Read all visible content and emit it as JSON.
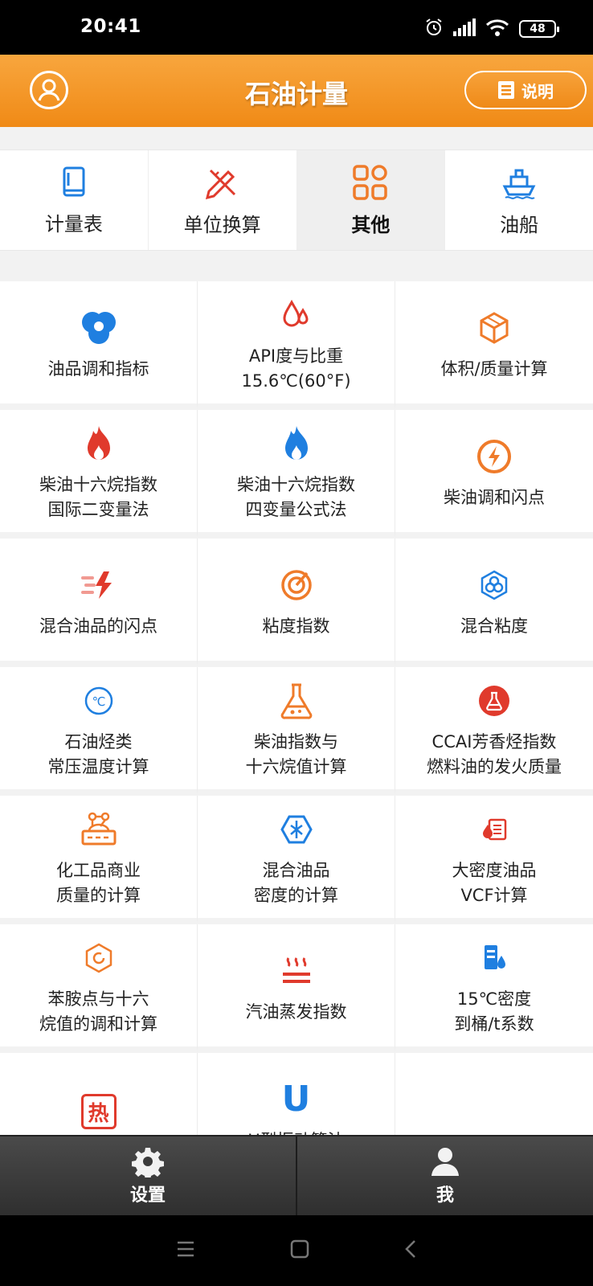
{
  "status_bar": {
    "time": "20:41",
    "battery": "48"
  },
  "header": {
    "title": "石油计量",
    "help_label": "说明"
  },
  "tabs": [
    {
      "label": "计量表",
      "icon": "book-icon",
      "active": false
    },
    {
      "label": "单位换算",
      "icon": "ruler-pencil-icon",
      "active": false
    },
    {
      "label": "其他",
      "icon": "grid-apps-icon",
      "active": true
    },
    {
      "label": "油船",
      "icon": "ship-icon",
      "active": false
    }
  ],
  "items": [
    {
      "label": "油品调和指标",
      "icon": "blend-circles-icon"
    },
    {
      "label": "API度与比重\n15.6℃(60°F)",
      "icon": "double-drop-icon"
    },
    {
      "label": "体积/质量计算",
      "icon": "cube-icon"
    },
    {
      "label": "柴油十六烷指数\n国际二变量法",
      "icon": "flame-red-icon"
    },
    {
      "label": "柴油十六烷指数\n四变量公式法",
      "icon": "flame-blue-icon"
    },
    {
      "label": "柴油调和闪点",
      "icon": "lightning-circle-icon"
    },
    {
      "label": "混合油品的闪点",
      "icon": "flash-speed-icon"
    },
    {
      "label": "粘度指数",
      "icon": "target-arrow-icon"
    },
    {
      "label": "混合粘度",
      "icon": "hex-flower-icon"
    },
    {
      "label": "石油烃类\n常压温度计算",
      "icon": "celsius-circle-icon"
    },
    {
      "label": "柴油指数与\n十六烷值计算",
      "icon": "flask-icon"
    },
    {
      "label": "CCAI芳香烃指数\n燃料油的发火质量",
      "icon": "red-flask-badge-icon"
    },
    {
      "label": "化工品商业\n质量的计算",
      "icon": "chemical-box-icon"
    },
    {
      "label": "混合油品\n密度的计算",
      "icon": "hex-wave-icon"
    },
    {
      "label": "大密度油品\nVCF计算",
      "icon": "drop-document-icon"
    },
    {
      "label": "苯胺点与十六\n烷值的调和计算",
      "icon": "hex-ring-icon"
    },
    {
      "label": "汽油蒸发指数",
      "icon": "heat-waves-icon"
    },
    {
      "label": "15℃密度\n到桶/t系数",
      "icon": "barrel-drop-icon"
    },
    {
      "label": "",
      "icon": "heat-char-icon",
      "glyph": "热"
    },
    {
      "label": "U型振动管法",
      "icon": "u-letter-icon",
      "glyph": "U"
    },
    {
      "label": "",
      "icon": ""
    }
  ],
  "bottom_nav": [
    {
      "label": "设置",
      "icon": "gear-icon"
    },
    {
      "label": "我",
      "icon": "user-icon"
    }
  ],
  "colors": {
    "orange": "#f08a16",
    "blue": "#1f7fe0",
    "red": "#e03a2c",
    "icon_orange": "#ef7b2a"
  }
}
